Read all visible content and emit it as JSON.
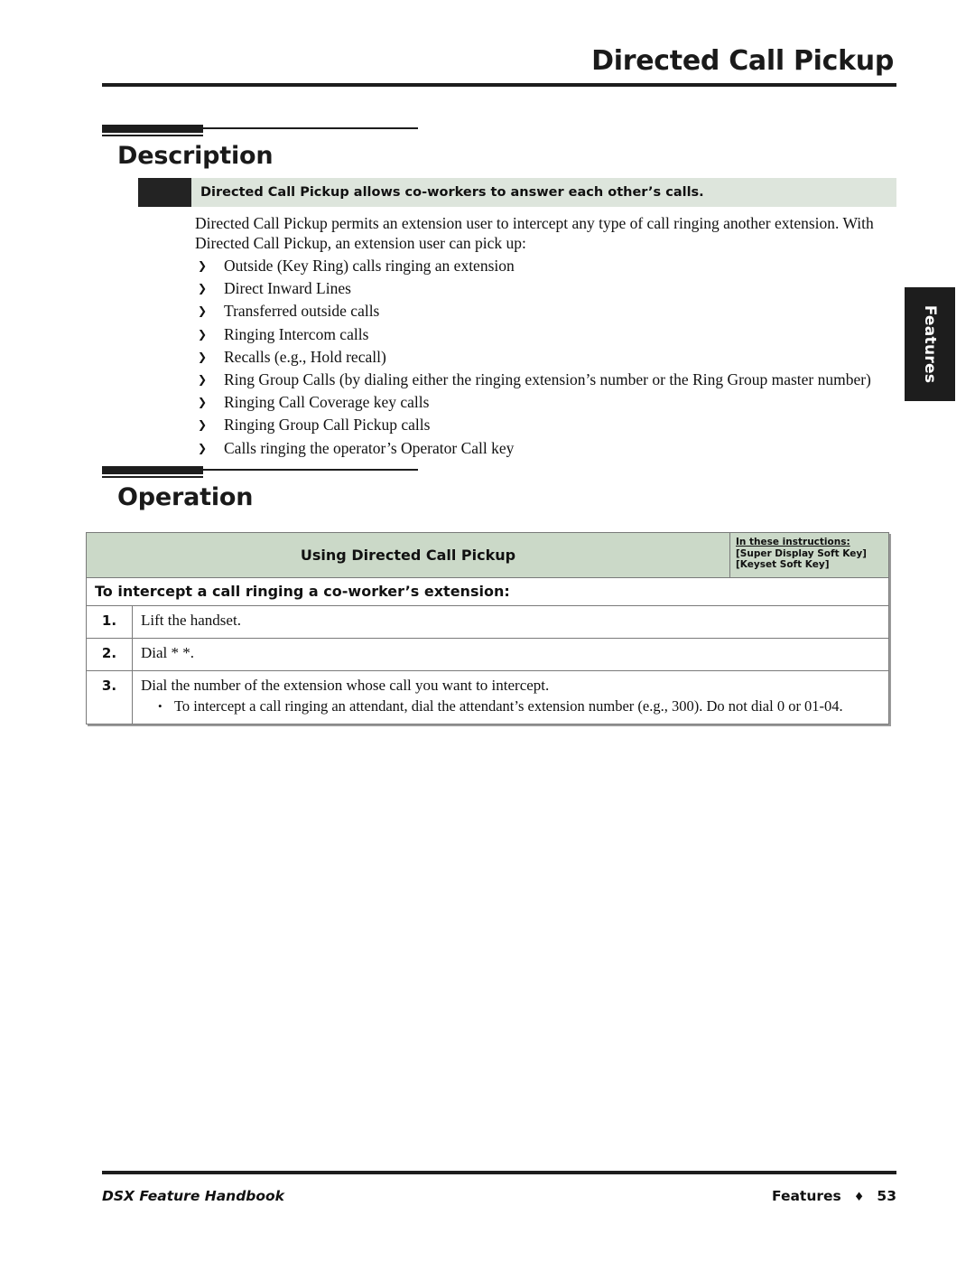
{
  "header": {
    "title": "Directed Call Pickup"
  },
  "sections": {
    "description": {
      "heading": "Description",
      "callout": "Directed Call Pickup allows co-workers to answer each other’s calls.",
      "intro": "Directed Call Pickup permits an extension user to intercept any type of call ringing another extension. With Directed Call Pickup, an extension user can pick up:",
      "bullet_glyph": "❯",
      "bullets": [
        "Outside (Key Ring) calls ringing an extension",
        "Direct Inward Lines",
        "Transferred outside calls",
        "Ringing Intercom calls",
        "Recalls (e.g., Hold recall)",
        "Ring Group Calls (by dialing either the ringing extension’s number or the Ring Group master number)",
        "Ringing Call Coverage key calls",
        "Ringing Group Call Pickup calls",
        "Calls ringing the operator’s Operator Call key"
      ]
    },
    "operation": {
      "heading": "Operation",
      "table": {
        "title": "Using Directed Call Pickup",
        "legend_title": "In these instructions:",
        "legend_lines": [
          "[Super Display Soft Key]",
          "[Keyset Soft Key]"
        ],
        "subhead": "To intercept a call ringing a co-worker’s extension:",
        "steps": [
          {
            "number": "1.",
            "text": "Lift the handset.",
            "sub": ""
          },
          {
            "number": "2.",
            "text": "Dial * *.",
            "sub": ""
          },
          {
            "number": "3.",
            "text": "Dial the number of the extension whose call you want to intercept.",
            "sub": "To intercept a call ringing an attendant, dial the attendant’s extension number (e.g., 300). Do not dial 0 or 01-04.",
            "sub_glyph": "•"
          }
        ]
      }
    }
  },
  "side_tab": {
    "label": "Features"
  },
  "footer": {
    "left": "DSX Feature Handbook",
    "section": "Features",
    "separator": "♦",
    "page_number": "53"
  },
  "colors": {
    "callout_bg": "#dde5dc",
    "table_header_bg": "#cbd9c8",
    "rule": "#1d1d1d",
    "tab_bg": "#1d1d1d"
  }
}
